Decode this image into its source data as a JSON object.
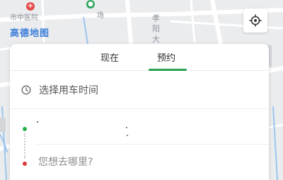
{
  "map": {
    "logo_text": "高德地图",
    "hospital_label": "市中医院",
    "hospital_prefix": "",
    "park_label": "场",
    "street_1": "孝阳大",
    "street_2": "",
    "street_3": "",
    "street_4": "",
    "hospital_icon": "hospital-pin-icon",
    "park_icon": "park-pin-icon",
    "colors": {
      "logo": "#3b7dd8",
      "road": "#ffffff",
      "river": "#9cc6ef"
    }
  },
  "locate_button": {
    "icon": "locate-crosshair-icon"
  },
  "panel": {
    "tabs": [
      {
        "label": "现在",
        "active": false
      },
      {
        "label": "预约",
        "active": true
      }
    ],
    "accent_color": "#27a251",
    "time_row": {
      "icon": "clock-icon",
      "label": "选择用车时间"
    },
    "start": {
      "value": ""
    },
    "destination": {
      "placeholder": "您想去哪里?"
    },
    "start_dot_color": "#24b14c",
    "end_dot_color": "#e03b3b"
  }
}
